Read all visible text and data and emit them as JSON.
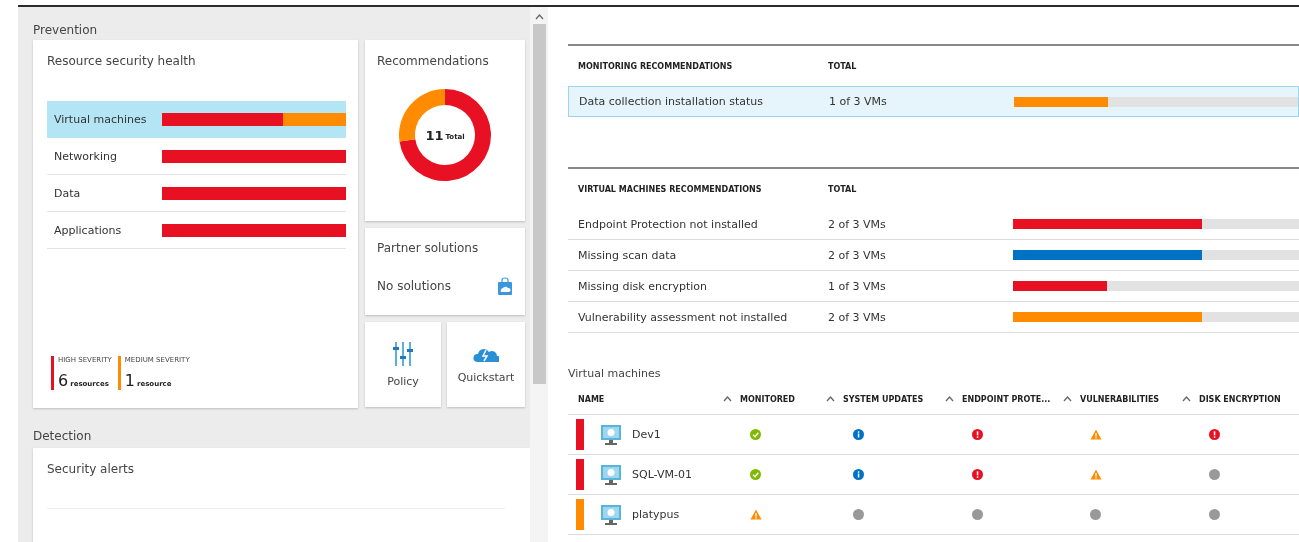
{
  "prevention": {
    "title": "Prevention",
    "resource_health": {
      "title": "Resource security health",
      "rows": [
        {
          "label": "Virtual machines",
          "selected": true,
          "segments": [
            {
              "color": "#e81123",
              "level": 0.66
            },
            {
              "color": "#ff8c00",
              "level": 0.34
            }
          ]
        },
        {
          "label": "Networking",
          "selected": false,
          "segments": [
            {
              "color": "#e81123",
              "level": 1
            }
          ]
        },
        {
          "label": "Data",
          "selected": false,
          "segments": [
            {
              "color": "#e81123",
              "level": 1
            }
          ]
        },
        {
          "label": "Applications",
          "selected": false,
          "segments": [
            {
              "color": "#e81123",
              "level": 1
            }
          ]
        }
      ],
      "legend": [
        {
          "label": "HIGH SEVERITY",
          "count": "6",
          "unit": "resources",
          "color": "#e81123"
        },
        {
          "label": "MEDIUM SEVERITY",
          "count": "1",
          "unit": "resource",
          "color": "#ff8c00"
        }
      ]
    },
    "recommendations": {
      "title": "Recommendations",
      "total": "11",
      "total_label": "Total"
    },
    "partner_solutions": {
      "title": "Partner solutions",
      "status": "No solutions"
    },
    "tiles": [
      {
        "kind": "policy",
        "label": "Policy"
      },
      {
        "kind": "quickstart",
        "label": "Quickstart"
      }
    ]
  },
  "detection": {
    "title": "Detection",
    "security_alerts": {
      "title": "Security alerts"
    }
  },
  "monitoring_recommendations": {
    "columns": [
      "MONITORING RECOMMENDATIONS",
      "TOTAL"
    ],
    "rows": [
      {
        "name": "Data collection installation status",
        "total": "1 of 3 VMs",
        "level": 0.33,
        "color": "#ff8c00",
        "selected": true
      }
    ]
  },
  "vm_recommendations": {
    "columns": [
      "VIRTUAL MACHINES RECOMMENDATIONS",
      "TOTAL"
    ],
    "rows": [
      {
        "name": "Endpoint Protection not installed",
        "total": "2 of 3 VMs",
        "level": 0.66,
        "color": "#e81123",
        "selected": false
      },
      {
        "name": "Missing scan data",
        "total": "2 of 3 VMs",
        "level": 0.66,
        "color": "#0072c6",
        "selected": false
      },
      {
        "name": "Missing disk encryption",
        "total": "1 of 3 VMs",
        "level": 0.33,
        "color": "#e81123",
        "selected": false
      },
      {
        "name": "Vulnerability assessment not installed",
        "total": "2 of 3 VMs",
        "level": 0.66,
        "color": "#ff8c00",
        "selected": false
      }
    ]
  },
  "virtual_machines": {
    "title": "Virtual machines",
    "columns": [
      "NAME",
      "MONITORED",
      "SYSTEM UPDATES",
      "ENDPOINT PROTE...",
      "VULNERABILITIES",
      "DISK ENCRYPTION"
    ],
    "rows": [
      {
        "name": "Dev1",
        "color": "#e81123",
        "cells": [
          {
            "kind": "ok"
          },
          {
            "kind": "info"
          },
          {
            "kind": "error"
          },
          {
            "kind": "warning"
          },
          {
            "kind": "error"
          }
        ]
      },
      {
        "name": "SQL-VM-01",
        "color": "#e81123",
        "cells": [
          {
            "kind": "ok"
          },
          {
            "kind": "info"
          },
          {
            "kind": "error"
          },
          {
            "kind": "warning"
          },
          {
            "kind": "none"
          }
        ]
      },
      {
        "name": "platypus",
        "color": "#ff8c00",
        "cells": [
          {
            "kind": "warning"
          },
          {
            "kind": "none"
          },
          {
            "kind": "none"
          },
          {
            "kind": "none"
          },
          {
            "kind": "none"
          }
        ]
      }
    ]
  }
}
